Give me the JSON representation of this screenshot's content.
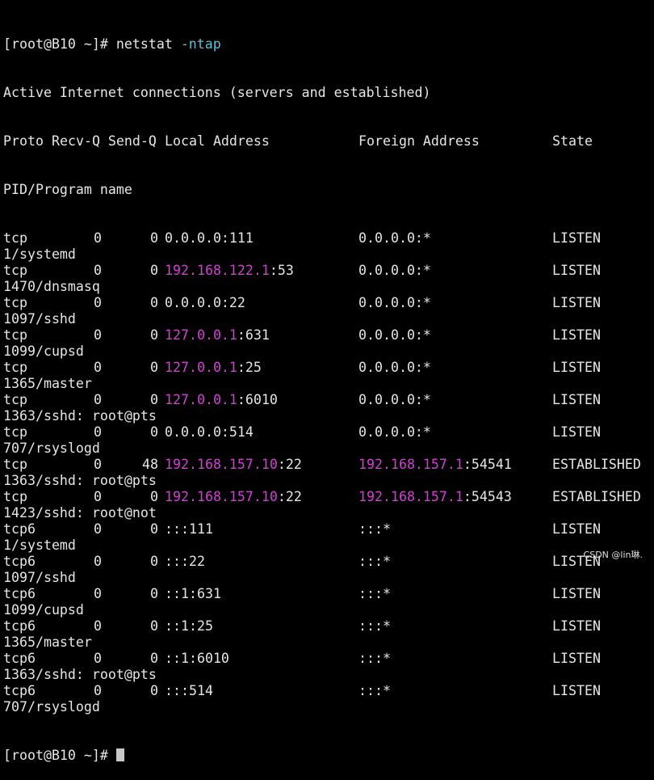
{
  "terminal": {
    "prompt": "[root@B10 ~]# ",
    "command": "netstat",
    "command_flag": "-ntap",
    "heading": "Active Internet connections (servers and established)",
    "columns": {
      "proto": "Proto",
      "recv_send": "Recv-Q Send-Q",
      "local": "Local Address",
      "foreign": "Foreign Address",
      "state": "State",
      "program": "PID/Program name"
    },
    "rows": [
      {
        "proto": "tcp",
        "recv": "0",
        "send": "0",
        "local_ip": "",
        "local_port": "0.0.0.0:111",
        "foreign_ip": "",
        "foreign_port": "0.0.0.0:*",
        "state": "LISTEN",
        "program": "1/systemd"
      },
      {
        "proto": "tcp",
        "recv": "0",
        "send": "0",
        "local_ip": "192.168.122.1",
        "local_port": ":53",
        "foreign_ip": "",
        "foreign_port": "0.0.0.0:*",
        "state": "LISTEN",
        "program": "1470/dnsmasq"
      },
      {
        "proto": "tcp",
        "recv": "0",
        "send": "0",
        "local_ip": "",
        "local_port": "0.0.0.0:22",
        "foreign_ip": "",
        "foreign_port": "0.0.0.0:*",
        "state": "LISTEN",
        "program": "1097/sshd"
      },
      {
        "proto": "tcp",
        "recv": "0",
        "send": "0",
        "local_ip": "127.0.0.1",
        "local_port": ":631",
        "foreign_ip": "",
        "foreign_port": "0.0.0.0:*",
        "state": "LISTEN",
        "program": "1099/cupsd"
      },
      {
        "proto": "tcp",
        "recv": "0",
        "send": "0",
        "local_ip": "127.0.0.1",
        "local_port": ":25",
        "foreign_ip": "",
        "foreign_port": "0.0.0.0:*",
        "state": "LISTEN",
        "program": "1365/master"
      },
      {
        "proto": "tcp",
        "recv": "0",
        "send": "0",
        "local_ip": "127.0.0.1",
        "local_port": ":6010",
        "foreign_ip": "",
        "foreign_port": "0.0.0.0:*",
        "state": "LISTEN",
        "program": "1363/sshd: root@pts"
      },
      {
        "proto": "tcp",
        "recv": "0",
        "send": "0",
        "local_ip": "",
        "local_port": "0.0.0.0:514",
        "foreign_ip": "",
        "foreign_port": "0.0.0.0:*",
        "state": "LISTEN",
        "program": "707/rsyslogd"
      },
      {
        "proto": "tcp",
        "recv": "0",
        "send": "48",
        "local_ip": "192.168.157.10",
        "local_port": ":22",
        "foreign_ip": "192.168.157.1",
        "foreign_port": ":54541",
        "state": "ESTABLISHED",
        "program": "1363/sshd: root@pts"
      },
      {
        "proto": "tcp",
        "recv": "0",
        "send": "0",
        "local_ip": "192.168.157.10",
        "local_port": ":22",
        "foreign_ip": "192.168.157.1",
        "foreign_port": ":54543",
        "state": "ESTABLISHED",
        "program": "1423/sshd: root@not"
      },
      {
        "proto": "tcp6",
        "recv": "0",
        "send": "0",
        "local_ip": "",
        "local_port": ":::111",
        "foreign_ip": "",
        "foreign_port": ":::*",
        "state": "LISTEN",
        "program": "1/systemd"
      },
      {
        "proto": "tcp6",
        "recv": "0",
        "send": "0",
        "local_ip": "",
        "local_port": ":::22",
        "foreign_ip": "",
        "foreign_port": ":::*",
        "state": "LISTEN",
        "program": "1097/sshd"
      },
      {
        "proto": "tcp6",
        "recv": "0",
        "send": "0",
        "local_ip": "",
        "local_port": "::1:631",
        "foreign_ip": "",
        "foreign_port": ":::*",
        "state": "LISTEN",
        "program": "1099/cupsd"
      },
      {
        "proto": "tcp6",
        "recv": "0",
        "send": "0",
        "local_ip": "",
        "local_port": "::1:25",
        "foreign_ip": "",
        "foreign_port": ":::*",
        "state": "LISTEN",
        "program": "1365/master"
      },
      {
        "proto": "tcp6",
        "recv": "0",
        "send": "0",
        "local_ip": "",
        "local_port": "::1:6010",
        "foreign_ip": "",
        "foreign_port": ":::*",
        "state": "LISTEN",
        "program": "1363/sshd: root@pts"
      },
      {
        "proto": "tcp6",
        "recv": "0",
        "send": "0",
        "local_ip": "",
        "local_port": ":::514",
        "foreign_ip": "",
        "foreign_port": ":::*",
        "state": "LISTEN",
        "program": "707/rsyslogd"
      }
    ],
    "final_prompt": "[root@B10 ~]# "
  },
  "watermark": "CSDN @lin琳.",
  "colors": {
    "background": "#000000",
    "text": "#e6e6e6",
    "ip_highlight": "#d33fd3",
    "flag_highlight": "#4fc3d9"
  }
}
